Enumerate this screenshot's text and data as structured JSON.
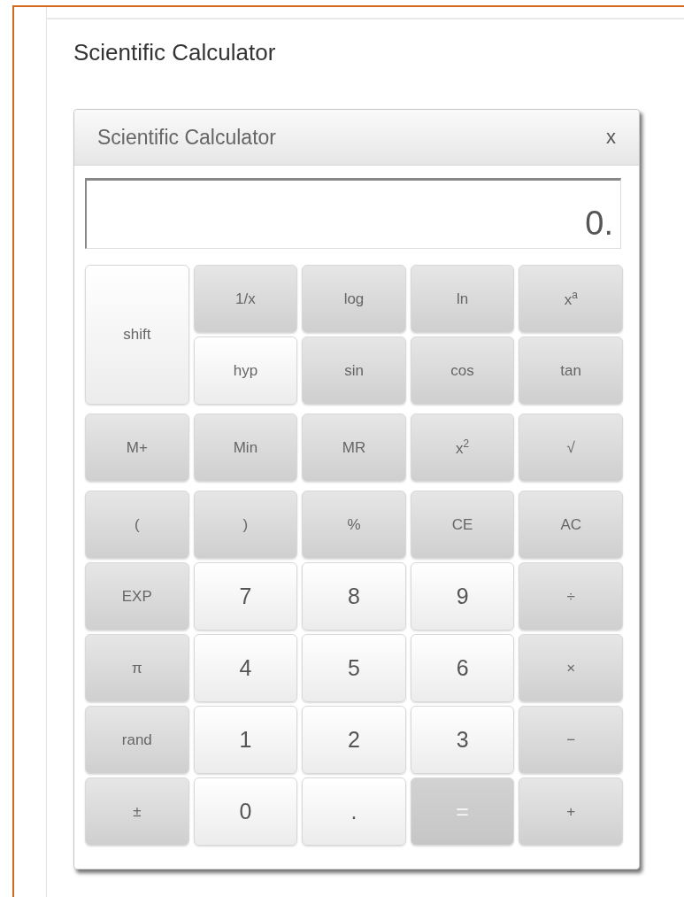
{
  "page_title": "Scientific Calculator",
  "calculator": {
    "title": "Scientific Calculator",
    "close": "x",
    "display": "0.",
    "groups": [
      {
        "keys": [
          {
            "label": "shift",
            "kind": "light",
            "tall": true
          },
          {
            "label": "1/x",
            "kind": "fn"
          },
          {
            "label": "log",
            "kind": "fn"
          },
          {
            "label": "ln",
            "kind": "fn"
          },
          {
            "label": "x$^{a}$",
            "kind": "fn"
          },
          {
            "label": "hyp",
            "kind": "light"
          },
          {
            "label": "sin",
            "kind": "fn"
          },
          {
            "label": "cos",
            "kind": "fn"
          },
          {
            "label": "tan",
            "kind": "fn"
          }
        ]
      },
      {
        "keys": [
          {
            "label": "M+",
            "kind": "fn"
          },
          {
            "label": "Min",
            "kind": "fn"
          },
          {
            "label": "MR",
            "kind": "fn"
          },
          {
            "label": "x$^{2}$",
            "kind": "fn"
          },
          {
            "label": "√",
            "kind": "fn"
          }
        ]
      },
      {
        "keys": [
          {
            "label": "(",
            "kind": "fn"
          },
          {
            "label": ")",
            "kind": "fn"
          },
          {
            "label": "%",
            "kind": "fn"
          },
          {
            "label": "CE",
            "kind": "fn"
          },
          {
            "label": "AC",
            "kind": "fn"
          },
          {
            "label": "EXP",
            "kind": "fn"
          },
          {
            "label": "7",
            "kind": "digit"
          },
          {
            "label": "8",
            "kind": "digit"
          },
          {
            "label": "9",
            "kind": "digit"
          },
          {
            "label": "÷",
            "kind": "fn"
          },
          {
            "label": "π",
            "kind": "fn"
          },
          {
            "label": "4",
            "kind": "digit"
          },
          {
            "label": "5",
            "kind": "digit"
          },
          {
            "label": "6",
            "kind": "digit"
          },
          {
            "label": "×",
            "kind": "fn"
          },
          {
            "label": "rand",
            "kind": "fn"
          },
          {
            "label": "1",
            "kind": "digit"
          },
          {
            "label": "2",
            "kind": "digit"
          },
          {
            "label": "3",
            "kind": "digit"
          },
          {
            "label": "−",
            "kind": "fn"
          },
          {
            "label": "±",
            "kind": "fn"
          },
          {
            "label": "0",
            "kind": "digit"
          },
          {
            "label": ".",
            "kind": "digit"
          },
          {
            "label": "=",
            "kind": "equals"
          },
          {
            "label": "+",
            "kind": "fn"
          }
        ]
      }
    ]
  }
}
